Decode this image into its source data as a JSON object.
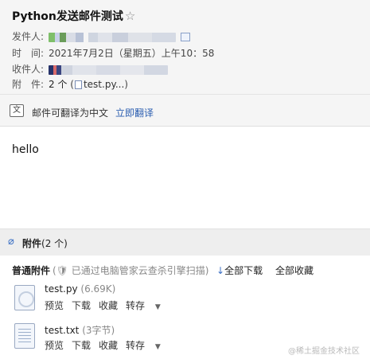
{
  "header": {
    "subject": "Python发送邮件测试",
    "star_icon": "☆",
    "sender_label": "发件人:",
    "time_label": "时　间:",
    "time_value": "2021年7月2日（星期五）上午10：58",
    "recipient_label": "收件人:",
    "attachment_label": "附　件:",
    "attachment_count": "2 个",
    "attachment_open": "(",
    "attachment_file": "test.py...",
    "attachment_close": ")"
  },
  "translate": {
    "text": "邮件可翻译为中文",
    "link": "立即翻译"
  },
  "body": {
    "text": "hello"
  },
  "attachments": {
    "title_bold": "附件",
    "title_count": "(2 个)",
    "normal_label": "普通附件",
    "scan_note": "(🛡 已通过电脑管家云查杀引擎扫描)",
    "download_all": "全部下载",
    "favorite_all": "全部收藏",
    "files": [
      {
        "name": "test.py",
        "size": "(6.69K)",
        "icon": "python-file-icon"
      },
      {
        "name": "test.txt",
        "size": "(3字节)",
        "icon": "text-file-icon"
      }
    ],
    "actions": {
      "preview": "预览",
      "download": "下载",
      "favorite": "收藏",
      "forward": "转存"
    }
  },
  "watermark": "@稀土掘金技术社区"
}
